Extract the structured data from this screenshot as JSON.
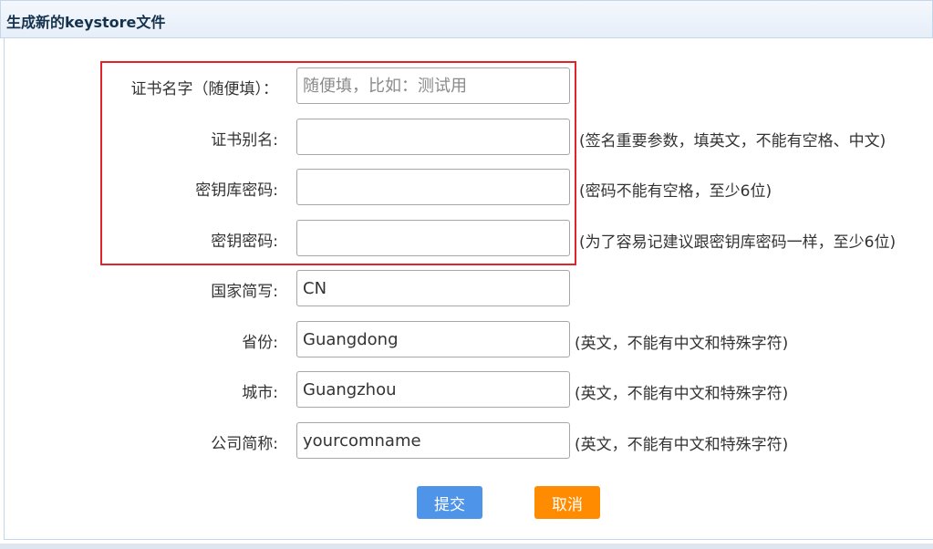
{
  "panel": {
    "title": "生成新的keystore文件"
  },
  "form": {
    "fields": [
      {
        "label": "证书名字（随便填）：",
        "value": "",
        "placeholder": "随便填，比如：测试用",
        "hint": ""
      },
      {
        "label": "证书别名:",
        "value": "",
        "placeholder": "",
        "hint": "(签名重要参数，填英文，不能有空格、中文)"
      },
      {
        "label": "密钥库密码:",
        "value": "",
        "placeholder": "",
        "hint": "(密码不能有空格，至少6位)"
      },
      {
        "label": "密钥密码:",
        "value": "",
        "placeholder": "",
        "hint": "(为了容易记建议跟密钥库密码一样，至少6位)"
      },
      {
        "label": "国家简写:",
        "value": "CN",
        "placeholder": "",
        "hint": ""
      },
      {
        "label": "省份:",
        "value": "Guangdong",
        "placeholder": "",
        "hint": "(英文，不能有中文和特殊字符)"
      },
      {
        "label": "城市:",
        "value": "Guangzhou",
        "placeholder": "",
        "hint": "(英文，不能有中文和特殊字符)"
      },
      {
        "label": "公司简称:",
        "value": "yourcomname",
        "placeholder": "",
        "hint": "(英文，不能有中文和特殊字符)"
      }
    ]
  },
  "actions": {
    "submit_label": "提交",
    "cancel_label": "取消"
  },
  "colors": {
    "highlight": "#e0242c",
    "submit": "#4e95ea",
    "cancel": "#ff8c00"
  }
}
